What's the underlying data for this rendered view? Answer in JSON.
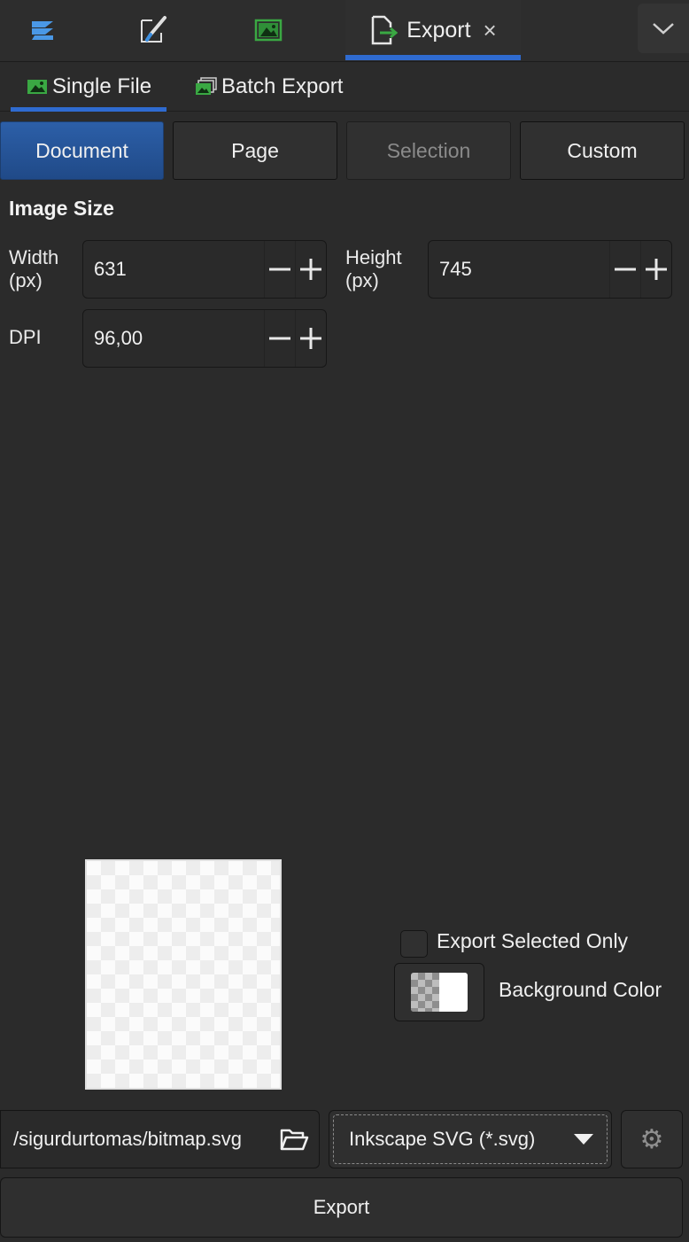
{
  "dock_tabs": [
    {
      "icon": "layers-icon"
    },
    {
      "icon": "fill-stroke-icon"
    },
    {
      "icon": "image-icon"
    },
    {
      "icon": "export-icon",
      "label": "Export",
      "close": "×"
    }
  ],
  "sub_tabs": {
    "single_file": "Single File",
    "batch_export": "Batch Export"
  },
  "modes": {
    "document": "Document",
    "page": "Page",
    "selection": "Selection",
    "custom": "Custom",
    "active": "Document"
  },
  "image_size": {
    "title": "Image Size",
    "width_label_1": "Width",
    "width_label_2": "(px)",
    "width_value": "631",
    "height_label_1": "Height",
    "height_label_2": "(px)",
    "height_value": "745",
    "dpi_label": "DPI",
    "dpi_value": "96,00"
  },
  "options": {
    "export_selected_only": "Export Selected Only",
    "export_selected_checked": false,
    "background_color": "Background Color"
  },
  "file": {
    "path": "/sigurdurtomas/bitmap.svg",
    "format": "Inkscape SVG (*.svg)"
  },
  "export_button": "Export",
  "colors": {
    "accent": "#2f6bd0",
    "active_button": "#2c5fa8",
    "icon_green": "#3aa843",
    "icon_blue": "#3d8fe0"
  }
}
